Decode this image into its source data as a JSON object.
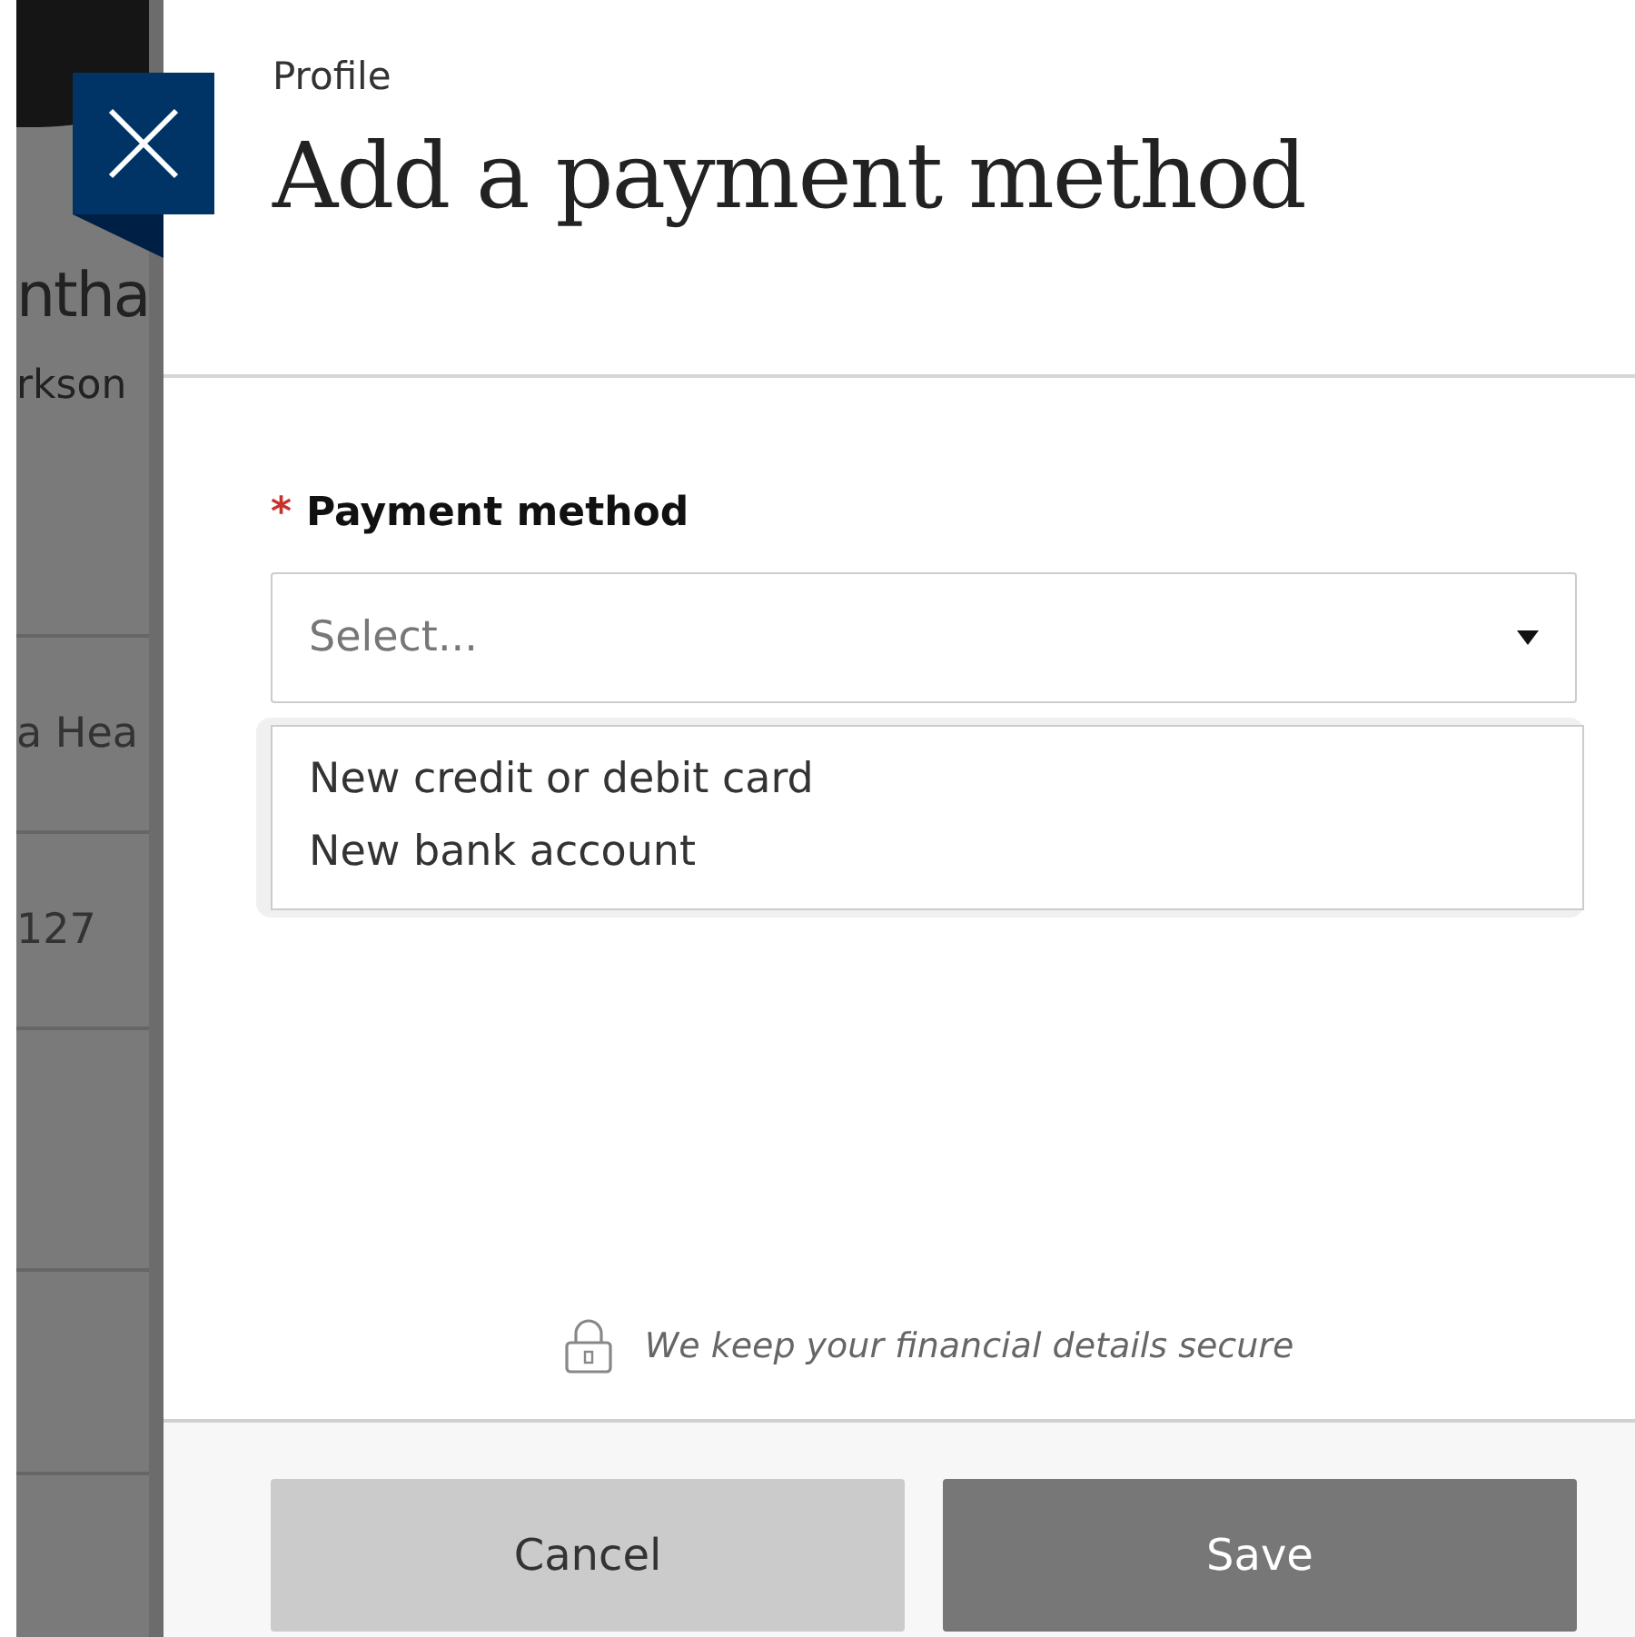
{
  "background": {
    "name": "ntha",
    "subtitle": "rkson",
    "rows": [
      "a Hea",
      "127"
    ]
  },
  "panel": {
    "breadcrumb": "Profile",
    "title": "Add a payment method"
  },
  "field": {
    "label": "Payment method",
    "required": true,
    "required_mark": "*",
    "placeholder": "Select...",
    "expanded": true,
    "options": [
      {
        "label": "New credit or debit card",
        "selected": false
      },
      {
        "label": "New bank account",
        "selected": false
      }
    ]
  },
  "security_note": "We keep your financial details secure",
  "buttons": [
    {
      "label": "Cancel",
      "kind": "secondary"
    },
    {
      "label": "Save",
      "kind": "primary"
    }
  ]
}
